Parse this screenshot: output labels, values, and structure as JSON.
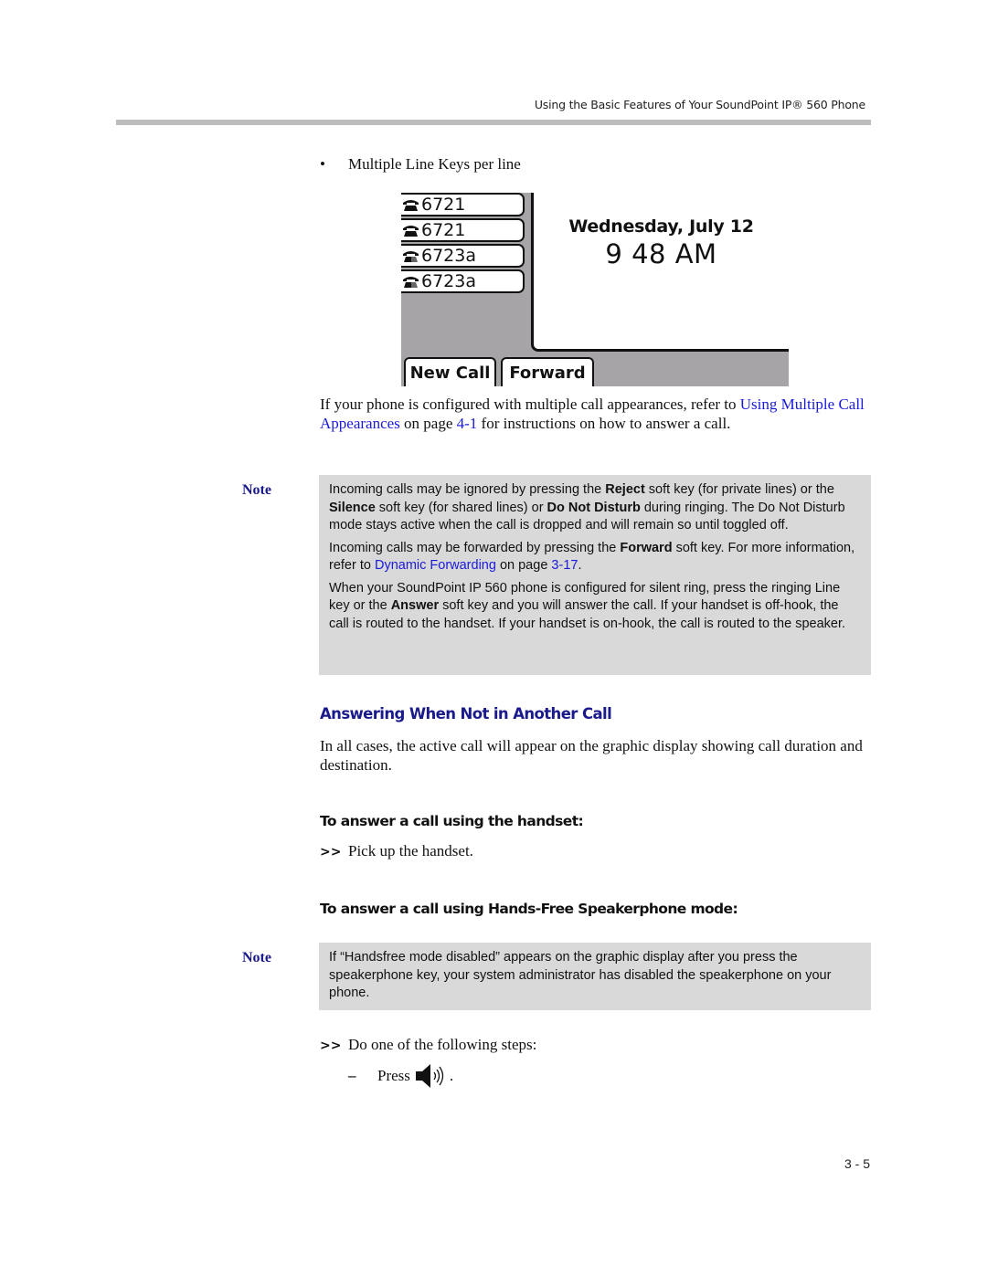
{
  "header": {
    "running_title": "Using the Basic Features of Your SoundPoint IP® 560 Phone"
  },
  "bullet": {
    "symbol": "•",
    "text": "Multiple Line Keys per line"
  },
  "phone_screen": {
    "line_keys": [
      {
        "label": "6721",
        "icon": "phone-handset-icon"
      },
      {
        "label": "6721",
        "icon": "phone-handset-icon"
      },
      {
        "label": "6723a",
        "icon": "shared-line-phone-icon"
      },
      {
        "label": "6723a",
        "icon": "shared-line-phone-icon"
      }
    ],
    "date": "Wednesday, July 12",
    "time": "9 48 AM",
    "softkeys": [
      {
        "label": "New Call"
      },
      {
        "label": "Forward"
      }
    ]
  },
  "intro_paragraph": {
    "before": "If your phone is configured with multiple call appearances, refer to ",
    "link1": "Using Multiple Call Appearances",
    "middle": " on page ",
    "link2": "4-1",
    "after": " for instructions on how to answer a call."
  },
  "note1": {
    "label": "Note",
    "p1": {
      "t1": "Incoming calls may be ignored by pressing the ",
      "b1": "Reject",
      "t2": " soft key (for private lines) or the ",
      "b2": "Silence",
      "t3": " soft key (for shared lines) or ",
      "b3": "Do Not Disturb",
      "t4": " during ringing. The Do Not Disturb mode stays active when the call is dropped and will remain so until toggled off."
    },
    "p2": {
      "t1": "Incoming calls may be forwarded by pressing the ",
      "b1": "Forward",
      "t2": " soft key. For more information, refer to ",
      "link1": "Dynamic Forwarding",
      "t3": " on page ",
      "link2": "3-17",
      "t4": "."
    },
    "p3": {
      "t1": "When your SoundPoint IP 560 phone is configured for silent ring, press the ringing Line key or the ",
      "b1": "Answer",
      "t2": " soft key and you will answer the call. If your handset is off-hook, the call is routed to the handset. If your handset is on-hook, the call is routed to the speaker."
    }
  },
  "section": {
    "heading": "Answering When Not in Another Call",
    "body": "In all cases, the active call will appear on the graphic display showing call duration and destination."
  },
  "procedure_handset": {
    "heading": "To answer a call using the handset:",
    "step_marker": ">>",
    "step": "Pick up the handset."
  },
  "procedure_speaker": {
    "heading": "To answer a call using Hands-Free Speakerphone mode:",
    "note_label": "Note",
    "note_text": "If “Handsfree mode disabled” appears on the graphic display after you press the speakerphone key, your system administrator has disabled the speakerphone on your phone.",
    "step_marker": ">>",
    "step": "Do one of the following steps:",
    "substep_marker": "–",
    "substep_text": "Press",
    "substep_icon": "speakerphone-icon",
    "substep_end": "."
  },
  "footer": {
    "page_number": "3 - 5"
  },
  "colors": {
    "link": "#1a1adb",
    "heading_blue": "#1a1a8c",
    "note_bg": "#d9d9d9",
    "header_rule": "#bdbdbd",
    "phone_bg": "#a6a4a6"
  }
}
